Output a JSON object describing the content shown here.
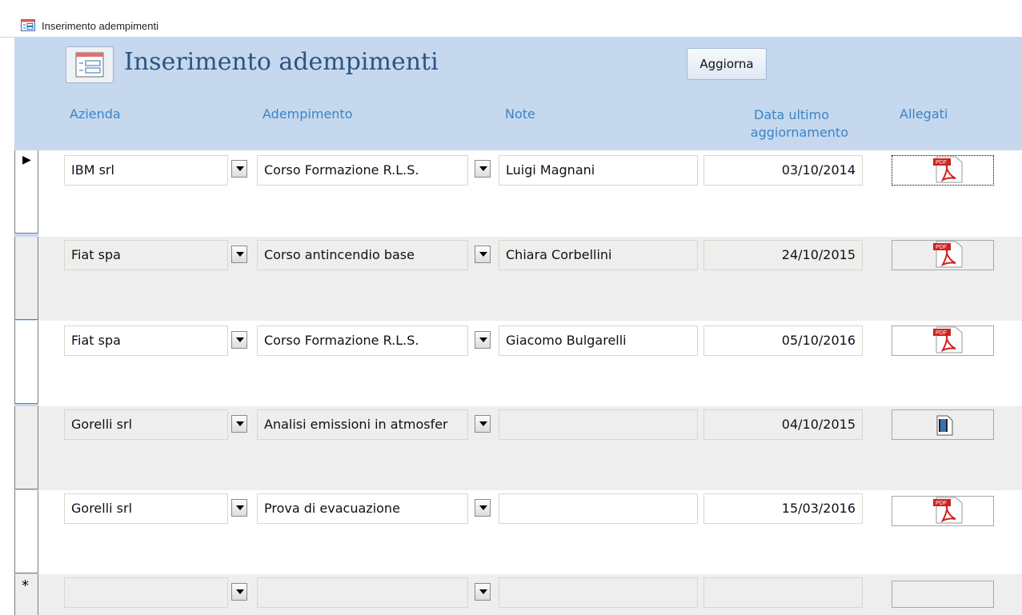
{
  "window": {
    "title": "Inserimento adempimenti"
  },
  "form": {
    "title": "Inserimento adempimenti",
    "refresh_button": "Aggiorna"
  },
  "columns": {
    "azienda": "Azienda",
    "adempimento": "Adempimento",
    "note": "Note",
    "data_line1": "Data ultimo",
    "data_line2": "aggiornamento",
    "allegati": "Allegati"
  },
  "rows": [
    {
      "azienda": "IBM srl",
      "adempimento": "Corso Formazione R.L.S.",
      "note": "Luigi Magnani",
      "data": "03/10/2014",
      "allegato": "pdf-icon",
      "current": true
    },
    {
      "azienda": "Fiat spa",
      "adempimento": "Corso antincendio base",
      "note": "Chiara Corbellini",
      "data": "24/10/2015",
      "allegato": "pdf-icon"
    },
    {
      "azienda": "Fiat spa",
      "adempimento": "Corso Formazione R.L.S.",
      "note": "Giacomo Bulgarelli",
      "data": "05/10/2016",
      "allegato": "pdf-icon"
    },
    {
      "azienda": "Gorelli srl",
      "adempimento": "Analisi emissioni in atmosfer",
      "note": "",
      "data": "04/10/2015",
      "allegato": "video-file-icon"
    },
    {
      "azienda": "Gorelli srl",
      "adempimento": "Prova di evacuazione",
      "note": "",
      "data": "15/03/2016",
      "allegato": "pdf-icon"
    }
  ],
  "new_record_marker": "*",
  "current_record_marker": "▶",
  "colors": {
    "header": "#c5d8ee",
    "column_heading": "#3b84c4",
    "title": "#2d5481",
    "alt_row": "#eeeeee"
  }
}
